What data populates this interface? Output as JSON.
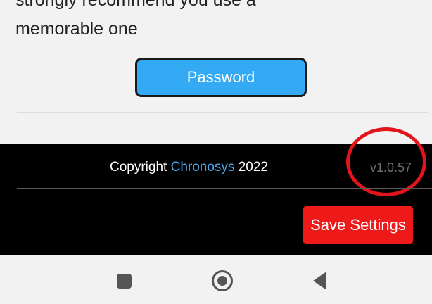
{
  "settings": {
    "previous_line_text": "strongly recommend you use a",
    "memorable_text": "memorable one",
    "password_button_label": "Password"
  },
  "footer": {
    "copyright_prefix": "Copyright ",
    "copyright_link": "Chronosys",
    "copyright_suffix": " 2022",
    "version": "v1.0.57",
    "save_button_label": "Save Settings"
  },
  "nav_bar": {
    "icons": [
      "recents-icon",
      "home-icon",
      "back-icon"
    ]
  },
  "colors": {
    "password_button": "#33aaf3",
    "save_button": "#ee1a1a",
    "link": "#4aa8f0",
    "annotation": "#e3141c",
    "footer_bg": "#000000"
  }
}
